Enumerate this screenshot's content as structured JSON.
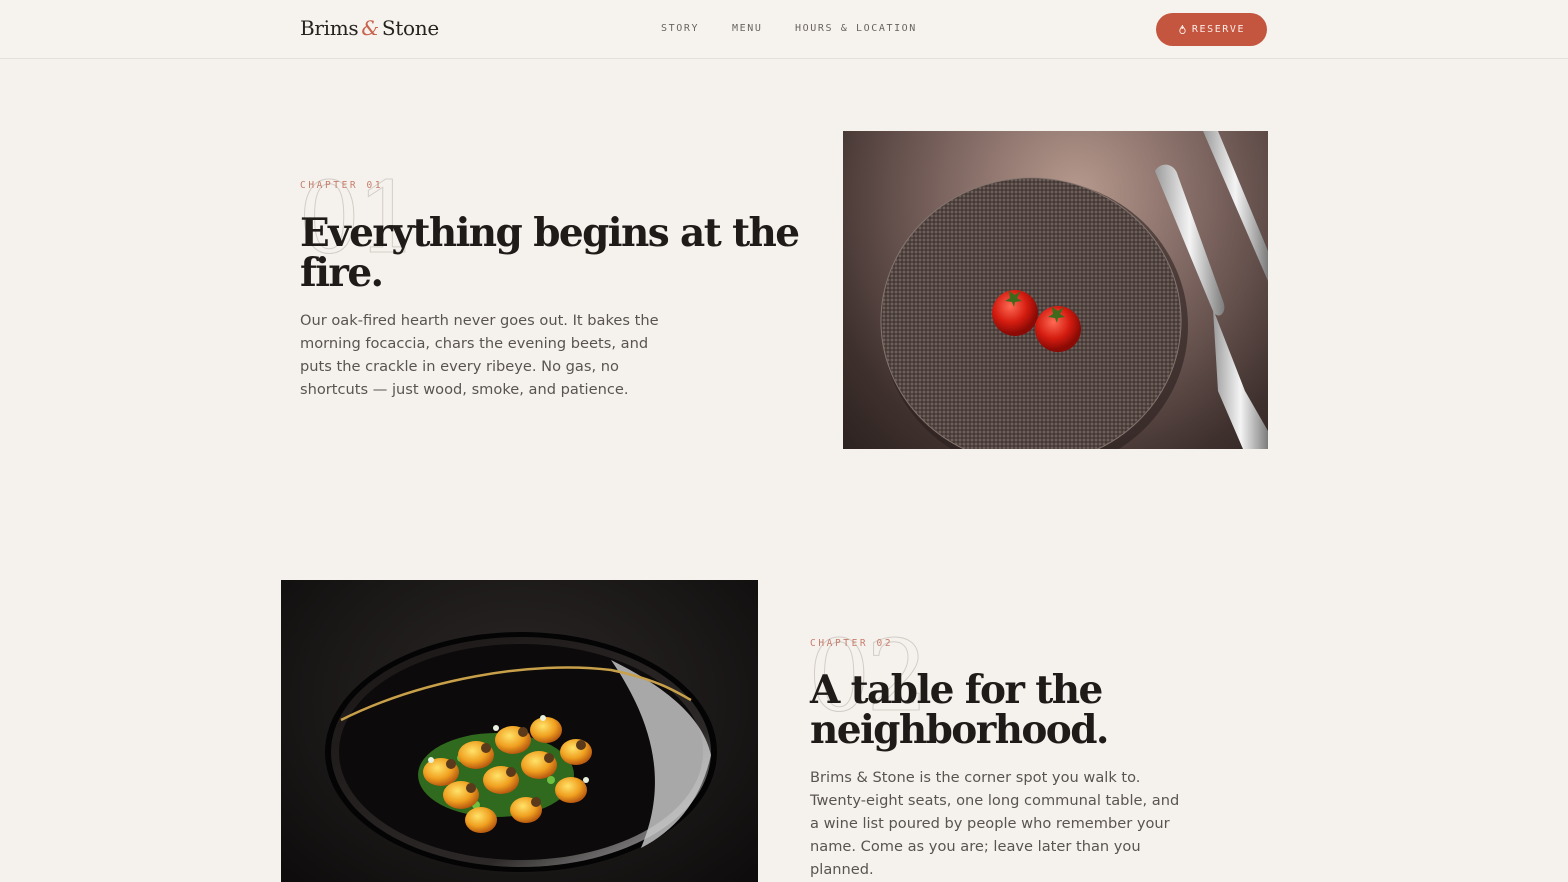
{
  "brand": {
    "name_part1": "Brims",
    "amp": "&",
    "name_part2": "Stone",
    "accent": "#c4553f"
  },
  "nav": {
    "items": [
      "STORY",
      "MENU",
      "HOURS & LOCATION"
    ]
  },
  "header": {
    "reserve_label": "RESERVE",
    "reserve_icon": "flame-icon"
  },
  "chapters": [
    {
      "label": "CHAPTER 01",
      "number": "01",
      "title_line1": "Everything begins at the",
      "title_line2": "fire.",
      "body_line1": "Our oak-fired hearth never goes out. It bakes the",
      "body_line2": "morning focaccia, chars the evening beets, and",
      "body_line3": "puts the crackle in every ribeye. No gas, no",
      "body_line4": "shortcuts — just wood, smoke, and patience."
    },
    {
      "label": "CHAPTER 02",
      "number": "02",
      "title_line1": "A table for the",
      "title_line2": "neighborhood.",
      "body_line1": "Brims & Stone is the corner spot you walk to.",
      "body_line2": "Twenty-eight seats, one long communal table, and",
      "body_line3": "a wine list poured by people who remember your",
      "body_line4": "name. Come as you are; leave later than you",
      "body_line5": "planned."
    }
  ]
}
